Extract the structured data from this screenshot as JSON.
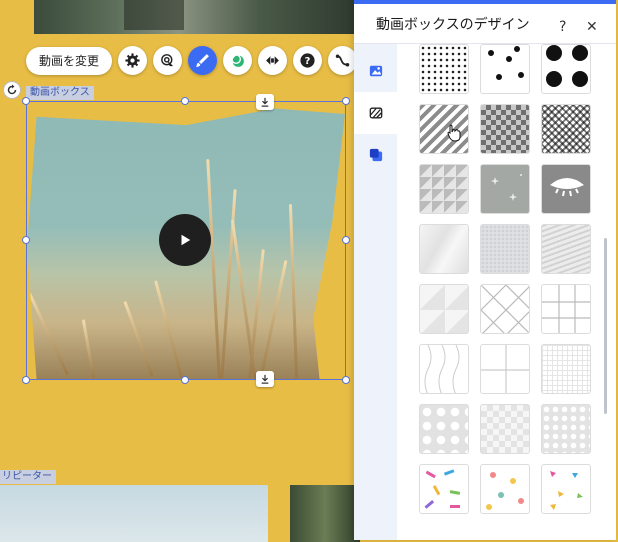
{
  "toolbar": {
    "change_video_label": "動画を変更",
    "buttons": [
      "gear-icon",
      "focal-point-icon",
      "design-brush-icon",
      "animation-icon",
      "back-forward-icon",
      "help-icon",
      "connect-icon"
    ]
  },
  "canvas": {
    "element_label": "動画ボックス",
    "repeater_label": "リピーター"
  },
  "panel": {
    "title": "動画ボックスのデザイン",
    "help_label": "?",
    "close_label": "✕",
    "accent_color": "#3b6bf2",
    "tabs": [
      "image-icon",
      "pattern-icon",
      "layers-icon"
    ],
    "selected_tab": "pattern-icon"
  },
  "patterns": [
    [
      "small-dots",
      "scattered-dots",
      "large-dots"
    ],
    [
      "diagonal-stripes",
      "checker-diamonds",
      "zigzag-diamonds"
    ],
    [
      "triangles",
      "sparkles",
      "eye"
    ],
    [
      "faceted-light",
      "marble-texture",
      "brush-texture"
    ],
    [
      "triangle-outline",
      "diamond-lattice",
      "square-grid"
    ],
    [
      "wavy-lines",
      "four-squares",
      "fine-grid"
    ],
    [
      "polka-dots-gray",
      "checker-gray",
      "dots-small-gray"
    ],
    [
      "confetti-sprinkles",
      "confetti-dots",
      "confetti-triangles"
    ]
  ]
}
